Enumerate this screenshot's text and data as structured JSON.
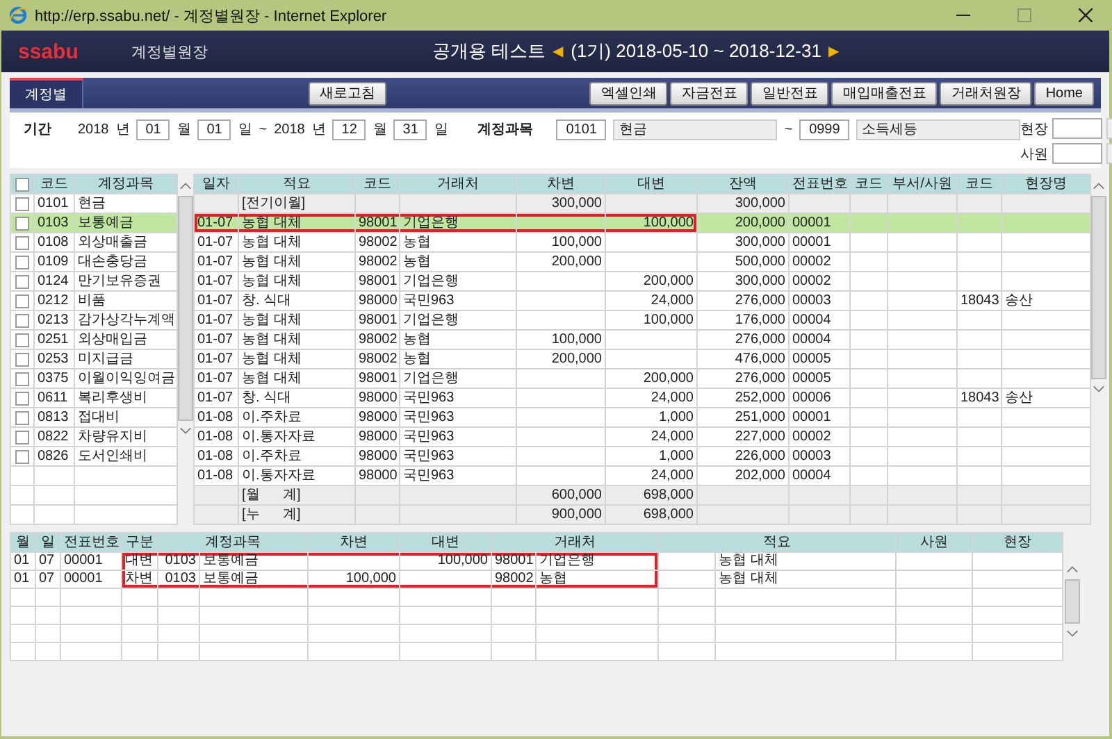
{
  "window": {
    "title": "http://erp.ssabu.net/ - 계정별원장 - Internet Explorer"
  },
  "header": {
    "logo": "ssabu",
    "page_title": "계정별원장",
    "company": "공개용 테스트",
    "prev": "◀",
    "period": "(1기) 2018-05-10 ~ 2018-12-31",
    "next": "▶"
  },
  "tabs": [
    {
      "label": "계정별",
      "selected": true
    }
  ],
  "refresh_button": "새로고침",
  "toolbar_buttons": [
    "엑셀인쇄",
    "자금전표",
    "일반전표",
    "매입매출전표",
    "거래처원장",
    "Home"
  ],
  "filter": {
    "period_label": "기간",
    "from_year": "2018",
    "year_unit": "년",
    "from_month": "01",
    "month_unit": "월",
    "from_day": "01",
    "day_unit": "일",
    "tilde": "~",
    "to_year": "2018",
    "to_year_unit": "년",
    "to_month": "12",
    "to_month_unit": "월",
    "to_day": "31",
    "to_day_unit": "일",
    "account_label": "계정과목",
    "account_from_code": "0101",
    "account_from_name": "현금",
    "account_tilde": "~",
    "account_to_code": "0999",
    "account_to_name": "소득세등",
    "site_label": "현장",
    "staff_label": "사원"
  },
  "accounts": {
    "columns": [
      "코드",
      "계정과목"
    ],
    "header_checked": false,
    "rows": [
      {
        "code": "0101",
        "name": "현금",
        "checked": false,
        "selected": false
      },
      {
        "code": "0103",
        "name": "보통예금",
        "checked": false,
        "selected": true
      },
      {
        "code": "0108",
        "name": "외상매출금",
        "checked": false,
        "selected": false
      },
      {
        "code": "0109",
        "name": "대손충당금",
        "checked": false,
        "selected": false
      },
      {
        "code": "0124",
        "name": "만기보유증권",
        "checked": false,
        "selected": false
      },
      {
        "code": "0212",
        "name": "비품",
        "checked": false,
        "selected": false
      },
      {
        "code": "0213",
        "name": "감가상각누계액",
        "checked": false,
        "selected": false
      },
      {
        "code": "0251",
        "name": "외상매입금",
        "checked": false,
        "selected": false
      },
      {
        "code": "0253",
        "name": "미지급금",
        "checked": false,
        "selected": false
      },
      {
        "code": "0375",
        "name": "이월이익잉여금",
        "checked": false,
        "selected": false
      },
      {
        "code": "0611",
        "name": "복리후생비",
        "checked": false,
        "selected": false
      },
      {
        "code": "0813",
        "name": "접대비",
        "checked": false,
        "selected": false
      },
      {
        "code": "0822",
        "name": "차량유지비",
        "checked": false,
        "selected": false
      },
      {
        "code": "0826",
        "name": "도서인쇄비",
        "checked": false,
        "selected": false
      }
    ]
  },
  "ledger": {
    "columns": [
      "일자",
      "적요",
      "코드",
      "거래처",
      "차변",
      "대변",
      "잔액",
      "전표번호",
      "코드",
      "부서/사원",
      "코드",
      "현장명"
    ],
    "rows": [
      {
        "kind": "carryover",
        "selected": false,
        "outlined": false,
        "summary": "[전기이월]",
        "debit": "300,000",
        "balance": "300,000"
      },
      {
        "kind": "entry",
        "selected": true,
        "outlined": true,
        "date": "01-07",
        "summary": "농협 대체",
        "vendor_code": "98001",
        "vendor": "기업은행",
        "credit": "100,000",
        "balance": "200,000",
        "voucher_no": "00001"
      },
      {
        "kind": "entry",
        "selected": false,
        "outlined": false,
        "date": "01-07",
        "summary": "농협 대체",
        "vendor_code": "98002",
        "vendor": "농협",
        "debit": "100,000",
        "balance": "300,000",
        "voucher_no": "00001"
      },
      {
        "kind": "entry",
        "selected": false,
        "outlined": false,
        "date": "01-07",
        "summary": "농협 대체",
        "vendor_code": "98002",
        "vendor": "농협",
        "debit": "200,000",
        "balance": "500,000",
        "voucher_no": "00002"
      },
      {
        "kind": "entry",
        "selected": false,
        "outlined": false,
        "date": "01-07",
        "summary": "농협 대체",
        "vendor_code": "98001",
        "vendor": "기업은행",
        "credit": "200,000",
        "balance": "300,000",
        "voucher_no": "00002"
      },
      {
        "kind": "entry",
        "selected": false,
        "outlined": false,
        "date": "01-07",
        "summary": "창. 식대",
        "vendor_code": "98000",
        "vendor": "국민963",
        "credit": "24,000",
        "balance": "276,000",
        "voucher_no": "00003",
        "site_code": "18043",
        "site": "송산"
      },
      {
        "kind": "entry",
        "selected": false,
        "outlined": false,
        "date": "01-07",
        "summary": "농협 대체",
        "vendor_code": "98001",
        "vendor": "기업은행",
        "credit": "100,000",
        "balance": "176,000",
        "voucher_no": "00004"
      },
      {
        "kind": "entry",
        "selected": false,
        "outlined": false,
        "date": "01-07",
        "summary": "농협 대체",
        "vendor_code": "98002",
        "vendor": "농협",
        "debit": "100,000",
        "balance": "276,000",
        "voucher_no": "00004"
      },
      {
        "kind": "entry",
        "selected": false,
        "outlined": false,
        "date": "01-07",
        "summary": "농협 대체",
        "vendor_code": "98002",
        "vendor": "농협",
        "debit": "200,000",
        "balance": "476,000",
        "voucher_no": "00005"
      },
      {
        "kind": "entry",
        "selected": false,
        "outlined": false,
        "date": "01-07",
        "summary": "농협 대체",
        "vendor_code": "98001",
        "vendor": "기업은행",
        "credit": "200,000",
        "balance": "276,000",
        "voucher_no": "00005"
      },
      {
        "kind": "entry",
        "selected": false,
        "outlined": false,
        "date": "01-07",
        "summary": "창. 식대",
        "vendor_code": "98000",
        "vendor": "국민963",
        "credit": "24,000",
        "balance": "252,000",
        "voucher_no": "00006",
        "site_code": "18043",
        "site": "송산"
      },
      {
        "kind": "entry",
        "selected": false,
        "outlined": false,
        "date": "01-08",
        "summary": "이.주차료",
        "vendor_code": "98000",
        "vendor": "국민963",
        "credit": "1,000",
        "balance": "251,000",
        "voucher_no": "00001"
      },
      {
        "kind": "entry",
        "selected": false,
        "outlined": false,
        "date": "01-08",
        "summary": "이.통자자료",
        "vendor_code": "98000",
        "vendor": "국민963",
        "credit": "24,000",
        "balance": "227,000",
        "voucher_no": "00002"
      },
      {
        "kind": "entry",
        "selected": false,
        "outlined": false,
        "date": "01-08",
        "summary": "이.주차료",
        "vendor_code": "98000",
        "vendor": "국민963",
        "credit": "1,000",
        "balance": "226,000",
        "voucher_no": "00003"
      },
      {
        "kind": "entry",
        "selected": false,
        "outlined": false,
        "date": "01-08",
        "summary": "이.통자자료",
        "vendor_code": "98000",
        "vendor": "국민963",
        "credit": "24,000",
        "balance": "202,000",
        "voucher_no": "00004"
      },
      {
        "kind": "total",
        "selected": false,
        "outlined": false,
        "summary": "[월      계]",
        "debit": "600,000",
        "credit": "698,000"
      },
      {
        "kind": "total",
        "selected": false,
        "outlined": false,
        "summary": "[누      계]",
        "debit": "900,000",
        "credit": "698,000"
      }
    ]
  },
  "voucher": {
    "columns": [
      "월",
      "일",
      "전표번호",
      "구분",
      "계정과목",
      "차변",
      "대변",
      "거래처",
      "적요",
      "사원",
      "현장"
    ],
    "rows": [
      {
        "outlined": true,
        "month": "01",
        "day": "07",
        "voucher_no": "00001",
        "type": "대변",
        "account_code": "0103",
        "account": "보통예금",
        "credit": "100,000",
        "vendor_code": "98001",
        "vendor": "기업은행",
        "summary": "농협 대체"
      },
      {
        "outlined": true,
        "month": "01",
        "day": "07",
        "voucher_no": "00001",
        "type": "차변",
        "account_code": "0103",
        "account": "보통예금",
        "debit": "100,000",
        "vendor_code": "98002",
        "vendor": "농협",
        "summary": "농협 대체"
      }
    ]
  }
}
